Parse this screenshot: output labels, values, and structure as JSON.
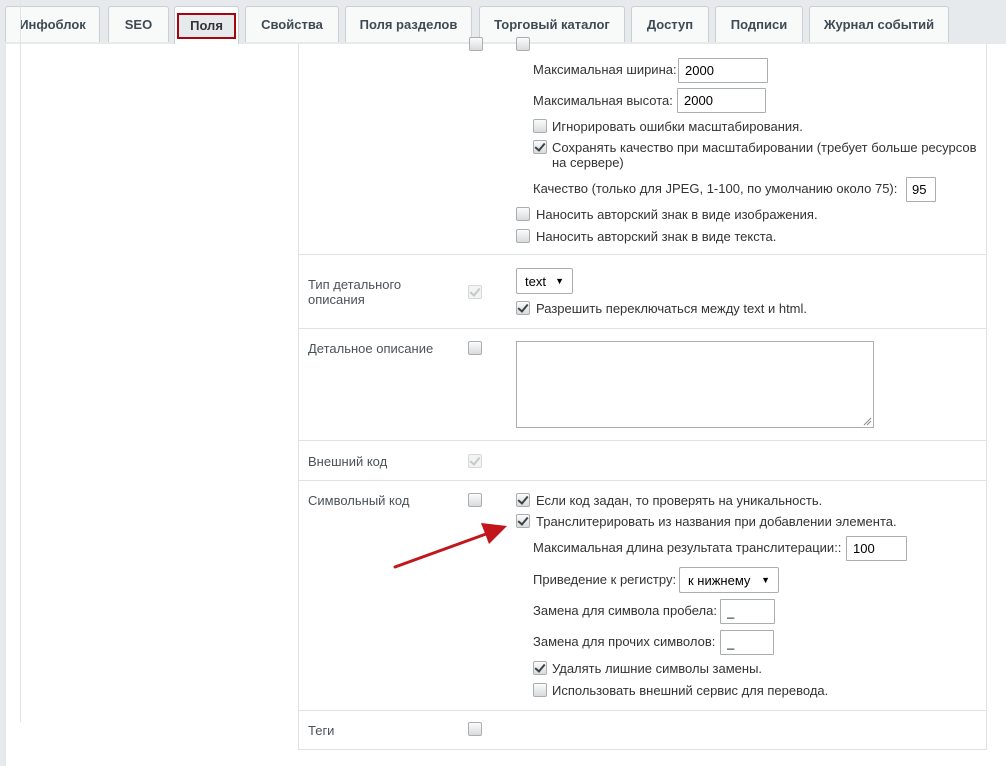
{
  "tabs": [
    {
      "label": "Инфоблок"
    },
    {
      "label": "SEO"
    },
    {
      "label": "Поля"
    },
    {
      "label": "Свойства"
    },
    {
      "label": "Поля разделов"
    },
    {
      "label": "Торговый каталог"
    },
    {
      "label": "Доступ"
    },
    {
      "label": "Подписи"
    },
    {
      "label": "Журнал событий"
    }
  ],
  "active_tab": "Поля",
  "image_settings": {
    "max_width_label": "Максимальная ширина:",
    "max_width_value": "2000",
    "max_height_label": "Максимальная высота:",
    "max_height_value": "2000",
    "ignore_errors": {
      "label": "Игнорировать ошибки масштабирования.",
      "checked": false
    },
    "keep_quality": {
      "label_line1": "Сохранять качество при масштабировании (требует больше ресурсов",
      "label_line2": "на сервере)",
      "checked": true
    },
    "quality_label": "Качество (только для JPEG, 1-100, по умолчанию около 75):",
    "quality_value": "95",
    "watermark_image": {
      "label": "Наносить авторский знак в виде изображения.",
      "checked": false
    },
    "watermark_text": {
      "label": "Наносить авторский знак в виде текста.",
      "checked": false
    }
  },
  "rows": {
    "detail_type": {
      "label_line1": "Тип детального",
      "label_line2": "описания",
      "select_value": "text",
      "allow_switch": {
        "label": "Разрешить переключаться между text и html.",
        "checked": true
      }
    },
    "detail_text": {
      "label": "Детальное описание",
      "textarea_value": ""
    },
    "external_code": {
      "label": "Внешний код"
    },
    "symbolic_code": {
      "label": "Символьный код",
      "check_unique": {
        "label": "Если код задан, то проверять на уникальность.",
        "checked": true
      },
      "transliterate": {
        "label": "Транслитерировать из названия при добавлении элемента.",
        "checked": true
      },
      "max_len_label": "Максимальная длина результата транслитерации::",
      "max_len_value": "100",
      "case_label": "Приведение к регистру:",
      "case_value": "к нижнему",
      "space_label": "Замена для символа пробела:",
      "space_value": "_",
      "other_label": "Замена для прочих символов:",
      "other_value": "_",
      "remove_extra": {
        "label": "Удалять лишние символы замены.",
        "checked": true
      },
      "use_service": {
        "label": "Использовать внешний сервис для перевода.",
        "checked": false
      }
    },
    "tags": {
      "label": "Теги"
    }
  },
  "colors": {
    "annotation_arrow": "#c0161c",
    "active_tab_border": "#a6050f"
  }
}
